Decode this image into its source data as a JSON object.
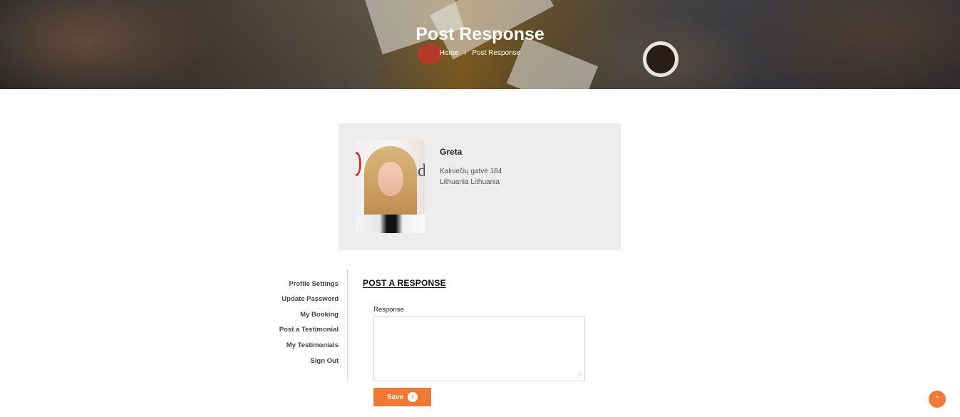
{
  "hero": {
    "title": "Post Response",
    "breadcrumb": {
      "home": "Home",
      "separator": "›",
      "current": "Post Response"
    }
  },
  "profile": {
    "name": "Greta",
    "address_line1": "Kalniečių gatvė 184",
    "address_line2": "Lithuania Lithuania"
  },
  "sidebar": {
    "items": [
      {
        "label": "Profile Settings"
      },
      {
        "label": "Update Password"
      },
      {
        "label": "My Booking"
      },
      {
        "label": "Post a Testimonial"
      },
      {
        "label": "My Testimonials"
      },
      {
        "label": "Sign Out"
      }
    ]
  },
  "form": {
    "title": "POST A RESPONSE",
    "response_label": "Response",
    "response_value": "",
    "save_label": "Save"
  },
  "colors": {
    "accent": "#f07a35"
  },
  "icons": {
    "save_icon": "chevron-right-circle-icon",
    "scroll_top_icon": "chevron-up-icon"
  }
}
